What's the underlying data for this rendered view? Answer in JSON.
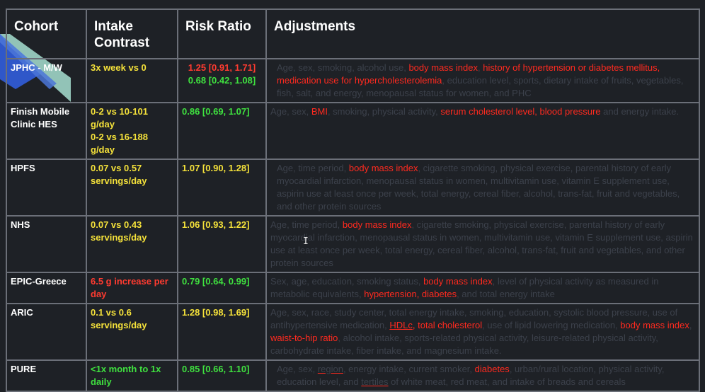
{
  "headers": {
    "cohort": "Cohort",
    "intake_line1": "Intake",
    "intake_line2": "Contrast",
    "risk_ratio": "Risk Ratio",
    "adjustments": "Adjustments"
  },
  "colors": {
    "background": "#1e2126",
    "grid": "#6b6f78",
    "header_text": "#ffffff",
    "yellow": "#f4e13a",
    "green": "#3fe03f",
    "red": "#ff3b30",
    "dim_text": "#3c414b"
  },
  "rows": [
    {
      "cohort": "JPHC - M/W",
      "intake": "3x week vs 0",
      "rr_a": "1.25 [0.91, 1.71]",
      "rr_b": "0.68 [0.42, 1.08]",
      "adj": [
        "Age, sex, smoking, alcohol use, ",
        "body mass index",
        ", ",
        "history of hypertension or diabetes mellitus, medication use for hypercholesterolemia",
        ", education level, sports, dietary intake of fruits, vegetables, fish, salt, and energy, menopausal status for women, and PHC",
        "",
        ""
      ]
    },
    {
      "cohort_l1": "Finish Mobile",
      "cohort_l2": "Clinic HES",
      "intake_l1": "0-2 vs 10-101",
      "intake_l2": "g/day",
      "intake_l3": "0-2 vs 16-188",
      "intake_l4": "g/day",
      "rr_a": "0.86 [0.69, 1.07]",
      "adj": [
        "Age, sex, ",
        "BMI",
        ", smoking, physical activity, ",
        "serum cholesterol level, blood pressure",
        " and energy intake."
      ]
    },
    {
      "cohort": "HPFS",
      "intake_l1": "0.07 vs 0.57",
      "intake_l2": "servings/day",
      "rr_a": "1.07 [0.90, 1.28]",
      "adj": [
        "Age, time period, ",
        "body mass index",
        ", cigarette smoking, physical exercise, parental history of early myocardial infarction, menopausal status in women, multivitamin use, vitamin E supplement use, aspirin use at least once per week, total energy, cereal fiber, alcohol, trans-fat, fruit and vegetables, and other protein sources"
      ]
    },
    {
      "cohort": "NHS",
      "intake_l1": "0.07 vs 0.43",
      "intake_l2": "servings/day",
      "rr_a": "1.06 [0.93, 1.22]",
      "adj": [
        "Age, time period, ",
        "body mass index",
        ", cigarette smoking, physical exercise, parental history of early myocardial infarction, menopausal status in women, multivitamin use, vitamin E supplement use, aspirin use at least once per week, total energy, cereal fiber, alcohol, trans-fat, fruit and vegetables, and other protein sources"
      ]
    },
    {
      "cohort": "EPIC-Greece",
      "intake_l1": "6.5 g increase per",
      "intake_l2": "day",
      "rr_a": "0.79 [0.64, 0.99]",
      "adj": [
        "Sex, age, education, smoking status, ",
        "body mass index",
        ", level of physical activity as measured in metabolic equivalents, ",
        "hypertension, diabetes",
        ", and total energy intake"
      ]
    },
    {
      "cohort": "ARIC",
      "intake_l1": "0.1 vs 0.6",
      "intake_l2": "servings/day",
      "rr_a": "1.28 [0.98, 1.69]",
      "adj": [
        "Age, sex, race, study center, total energy intake, smoking, education, systolic blood pressure, use of antihypertensive medication, ",
        "",
        "",
        "HDLc",
        ", total cholesterol",
        ", use of lipid lowering medication, ",
        "body mass index",
        ", ",
        "waist-to-hip ratio",
        ", alcohol intake, sports-related physical activity, leisure-related physical activity, carbohydrate intake, fiber intake, and magnesium intake."
      ]
    },
    {
      "cohort": "PURE",
      "intake_l1": "<1x month to 1x",
      "intake_l2": "daily",
      "rr_a": "0.85 [0.66, 1.10]",
      "adj": [
        "Age, sex, ",
        "region",
        ", energy intake, current smoker, ",
        "diabetes",
        ", urban/rural location, physical activity, education level, and ",
        "tertiles",
        " of white meat, red meat, and intake of breads and cereals"
      ]
    }
  ]
}
